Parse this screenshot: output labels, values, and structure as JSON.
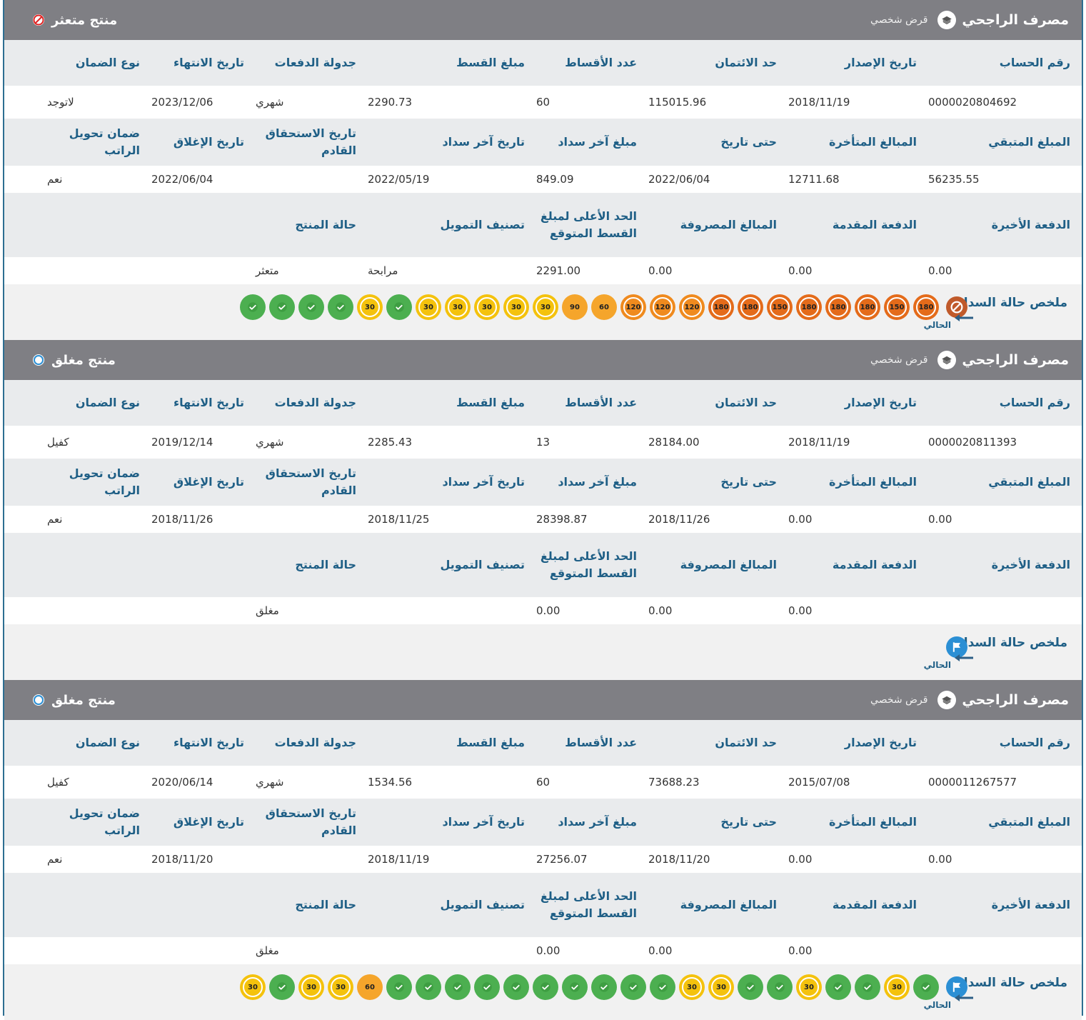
{
  "colors": {
    "header_bg": "#7f7f84",
    "accent": "#1f5f86",
    "paid": "#4caf50",
    "late30": "#f4c20d",
    "late60_plus": "#ef8a1e",
    "flag": "#2b8fd4"
  },
  "labels": {
    "account_number": "رقم الحساب",
    "issue_date": "تاريخ الإصدار",
    "credit_limit": "حد الائتمان",
    "installments_count": "عدد الأقساط",
    "installment_amount": "مبلغ القسط",
    "payment_schedule": "جدولة الدفعات",
    "end_date": "تاريخ الانتهاء",
    "guarantee_type": "نوع الضمان",
    "remaining_amount": "المبلغ المتبقي",
    "overdue_amount": "المبالغ المتأخرة",
    "as_of_date": "حتى تاريخ",
    "last_payment_amount": "مبلغ آخر سداد",
    "last_payment_date": "تاريخ آخر سداد",
    "next_due_date": "تاريخ الاستحقاق القادم",
    "close_date": "تاريخ الإغلاق",
    "salary_transfer": "ضمان تحويل الراتب",
    "last_payment": "الدفعة الأخيرة",
    "down_payment": "الدفعة المقدمة",
    "disbursed_amounts": "المبالغ المصروفة",
    "max_installment": "الحد الأعلى لمبلغ القسط المتوقع",
    "finance_class": "تصنيف التمويل",
    "product_status": "حالة المنتج",
    "summary": "ملخص حالة السداد",
    "current": "الحالي"
  },
  "cards": [
    {
      "bank": "مصرف الراجحي",
      "product_type": "قرض شخصي",
      "status": "منتج متعثر",
      "status_icon": "blocked-icon",
      "current_icon": "blocked-icon",
      "row1": [
        "0000020804692",
        "2018/11/19",
        "115015.96",
        "60",
        "2290.73",
        "شهري",
        "2023/12/06",
        "لاتوجد"
      ],
      "row2": [
        "56235.55",
        "12711.68",
        "2022/06/04",
        "849.09",
        "2022/05/19",
        "",
        "2022/06/04",
        "نعم"
      ],
      "row3": [
        "0.00",
        "0.00",
        "0.00",
        "2291.00",
        "مرابحة",
        "متعثر"
      ],
      "history": [
        "180",
        "150",
        "180",
        "180",
        "180",
        "150",
        "180",
        "180",
        "120",
        "120",
        "120",
        "60",
        "90",
        "30",
        "30",
        "30",
        "30",
        "30",
        "ok",
        "30",
        "ok",
        "ok",
        "ok",
        "ok"
      ]
    },
    {
      "bank": "مصرف الراجحي",
      "product_type": "قرض شخصي",
      "status": "منتج مغلق",
      "status_icon": "circle-icon",
      "current_icon": "flag-icon",
      "row1": [
        "0000020811393",
        "2018/11/19",
        "28184.00",
        "13",
        "2285.43",
        "شهري",
        "2019/12/14",
        "كفيل"
      ],
      "row2": [
        "0.00",
        "0.00",
        "2018/11/26",
        "28398.87",
        "2018/11/25",
        "",
        "2018/11/26",
        "نعم"
      ],
      "row3": [
        "",
        "0.00",
        "0.00",
        "0.00",
        "",
        "مغلق"
      ],
      "history": []
    },
    {
      "bank": "مصرف الراجحي",
      "product_type": "قرض شخصي",
      "status": "منتج مغلق",
      "status_icon": "circle-icon",
      "current_icon": "flag-icon",
      "row1": [
        "0000011267577",
        "2015/07/08",
        "73688.23",
        "60",
        "1534.56",
        "شهري",
        "2020/06/14",
        "كفيل"
      ],
      "row2": [
        "0.00",
        "0.00",
        "2018/11/20",
        "27256.07",
        "2018/11/19",
        "",
        "2018/11/20",
        "نعم"
      ],
      "row3": [
        "",
        "0.00",
        "0.00",
        "0.00",
        "",
        "مغلق"
      ],
      "history": [
        "ok",
        "30",
        "ok",
        "ok",
        "30",
        "ok",
        "ok",
        "30",
        "30",
        "ok",
        "ok",
        "ok",
        "ok",
        "ok",
        "ok",
        "ok",
        "ok",
        "ok",
        "ok",
        "60",
        "30",
        "30",
        "ok",
        "30"
      ]
    }
  ]
}
